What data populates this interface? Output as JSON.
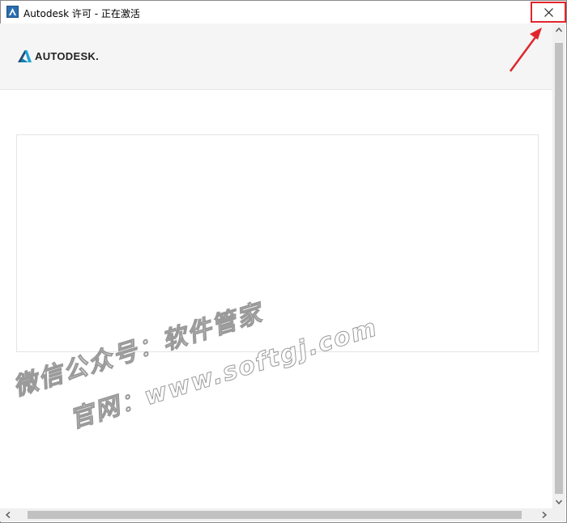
{
  "window": {
    "title": "Autodesk 许可 - 正在激活",
    "icon": "autodesk-app-icon",
    "close_icon": "close-icon"
  },
  "header": {
    "logo_text": "AUTODESK.",
    "logo_icon": "autodesk-logo-icon"
  },
  "annotation": {
    "highlight_color": "#e0262c"
  },
  "watermark": {
    "line1": "微信公众号：软件管家",
    "line2": "官网：www.softgj.com"
  },
  "colors": {
    "header_bg": "#f5f5f5",
    "scrollbar_thumb": "#c1c1c1"
  }
}
